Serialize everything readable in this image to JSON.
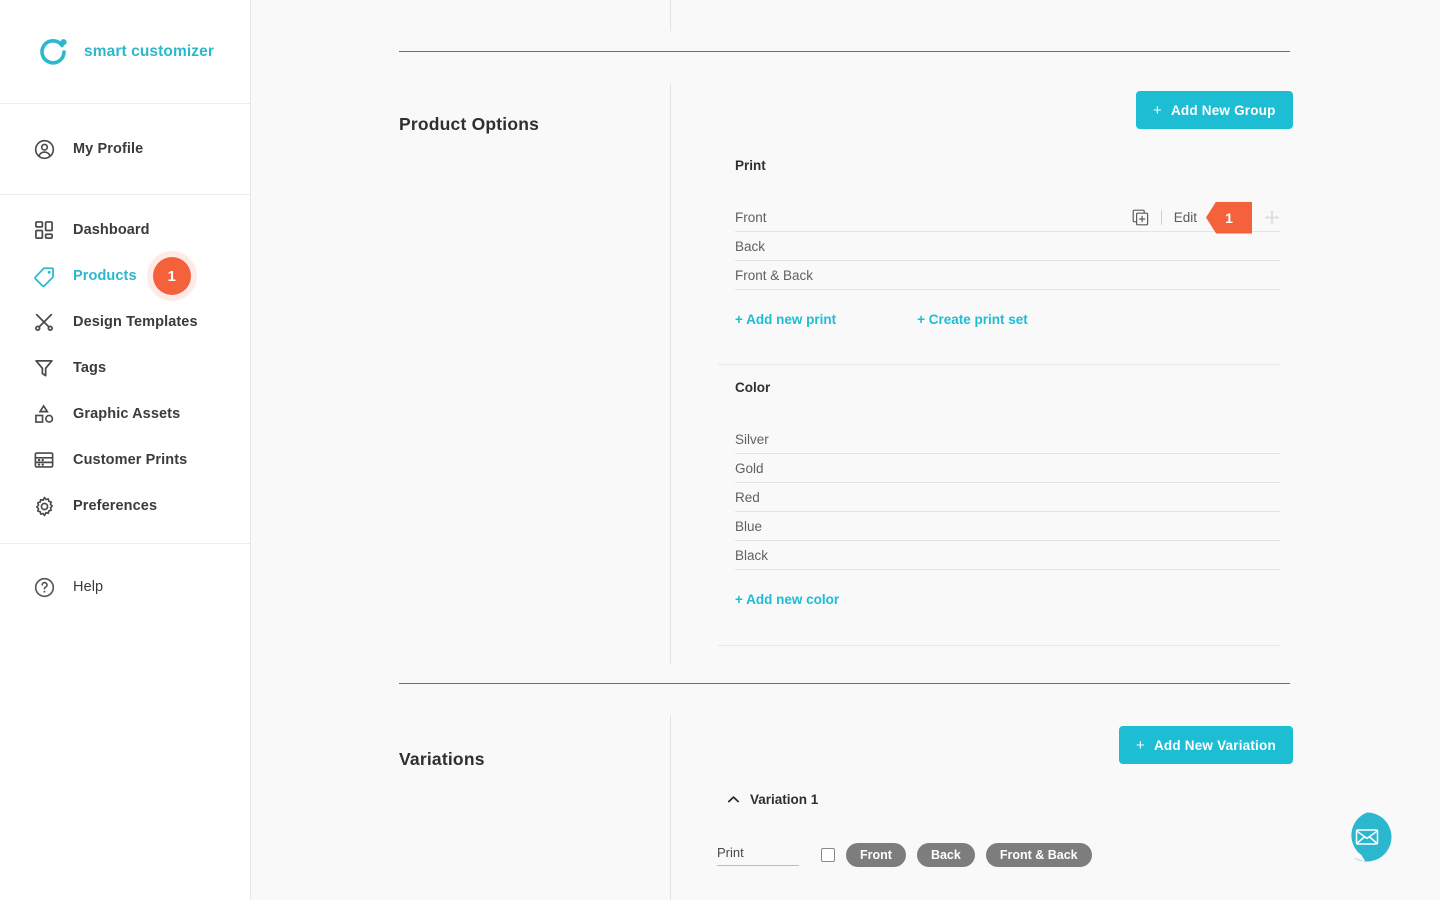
{
  "brand": {
    "name": "smart customizer",
    "logo_icon": "ring-dot-logo-icon",
    "accent_teal": "#1dbdd4",
    "accent_orange": "#f4613a"
  },
  "sidebar": {
    "profile": {
      "label": "My Profile",
      "icon": "user-circle-icon"
    },
    "items": [
      {
        "label": "Dashboard",
        "icon": "dashboard-grid-icon",
        "active": false,
        "badge": null
      },
      {
        "label": "Products",
        "icon": "tag-icon",
        "active": true,
        "badge": "1"
      },
      {
        "label": "Design Templates",
        "icon": "design-templates-icon",
        "active": false,
        "badge": null
      },
      {
        "label": "Tags",
        "icon": "funnel-icon",
        "active": false,
        "badge": null
      },
      {
        "label": "Graphic Assets",
        "icon": "shapes-icon",
        "active": false,
        "badge": null
      },
      {
        "label": "Customer Prints",
        "icon": "customer-prints-icon",
        "active": false,
        "badge": null
      },
      {
        "label": "Preferences",
        "icon": "gear-icon",
        "active": false,
        "badge": null
      }
    ],
    "help": {
      "label": "Help",
      "icon": "question-circle-icon"
    }
  },
  "product_options": {
    "title": "Product Options",
    "add_group_button": "Add New Group",
    "add_group_plus": "+",
    "groups": [
      {
        "name": "Print",
        "options": [
          {
            "name": "Front",
            "has_actions": true
          },
          {
            "name": "Back",
            "has_actions": false
          },
          {
            "name": "Front & Back",
            "has_actions": false
          }
        ],
        "row_actions": {
          "duplicate_icon": "duplicate-icon",
          "edit_label": "Edit",
          "badge_number": "1",
          "move_icon": "move-handle-icon"
        },
        "links": [
          {
            "label": "+ Add new print"
          },
          {
            "label": "+ Create print set"
          }
        ]
      },
      {
        "name": "Color",
        "options": [
          {
            "name": "Silver",
            "has_actions": false
          },
          {
            "name": "Gold",
            "has_actions": false
          },
          {
            "name": "Red",
            "has_actions": false
          },
          {
            "name": "Blue",
            "has_actions": false
          },
          {
            "name": "Black",
            "has_actions": false
          }
        ],
        "links": [
          {
            "label": "+ Add new color"
          }
        ]
      }
    ]
  },
  "variations": {
    "title": "Variations",
    "add_variation_button": "Add New Variation",
    "add_variation_plus": "+",
    "items": [
      {
        "title": "Variation 1",
        "expanded": true,
        "collapse_icon": "chevron-up-icon",
        "row": {
          "field_label": "Print",
          "checkbox_checked": false,
          "pills": [
            "Front",
            "Back",
            "Front & Back"
          ]
        }
      }
    ]
  },
  "chat_widget": {
    "icon": "envelope-chat-icon",
    "color": "#2bb7cd"
  }
}
